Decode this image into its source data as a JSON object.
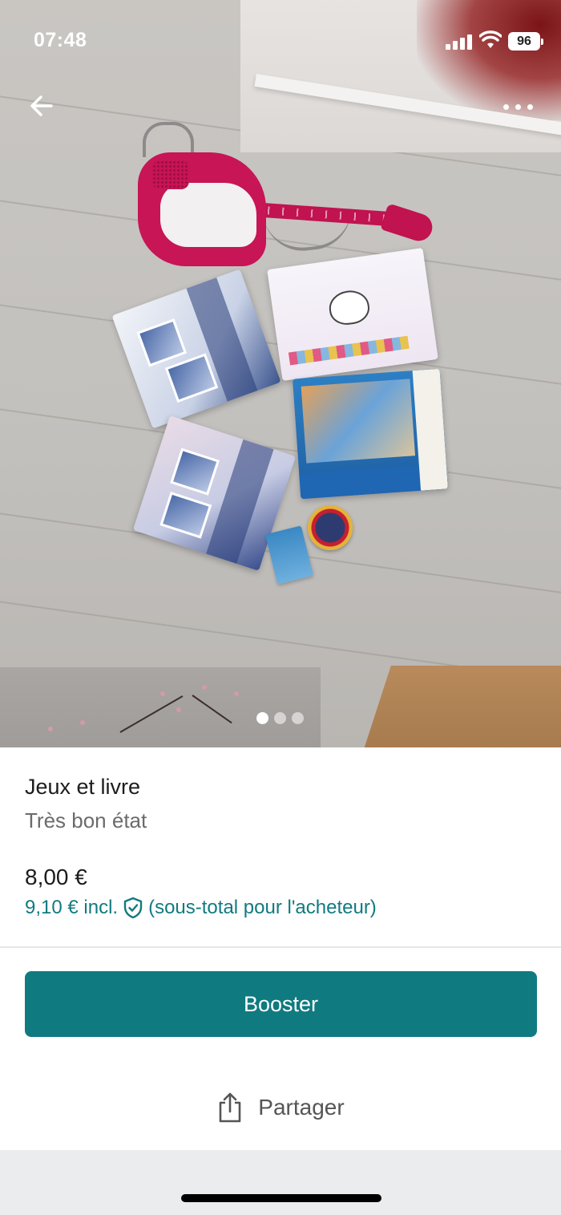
{
  "status_bar": {
    "time": "07:48",
    "battery": "96"
  },
  "photo": {
    "page_count": 3,
    "active_page": 1,
    "alt": ""
  },
  "item": {
    "title": "Jeux et livre",
    "condition": "Très bon état",
    "price": "8,00 €",
    "buyer_price": "9,10 € incl.",
    "buyer_note": "(sous-total pour l'acheteur)"
  },
  "actions": {
    "booster_label": "Booster",
    "share_label": "Partager"
  },
  "icons": {
    "back": "back-arrow-icon",
    "more": "more-dots-icon",
    "shield": "shield-check-icon",
    "share": "share-icon"
  },
  "colors": {
    "accent": "#0f7b80",
    "link": "#117a80"
  }
}
